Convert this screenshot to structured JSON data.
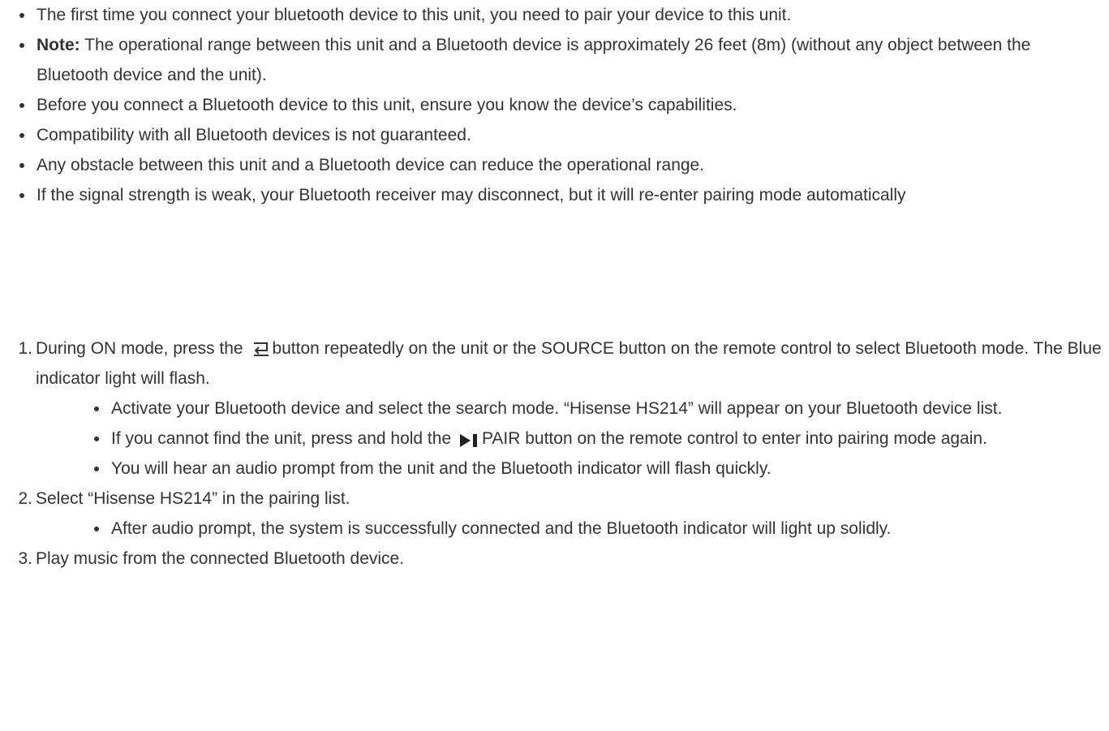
{
  "notes": [
    {
      "text": "The first time you connect your bluetooth device to this unit, you need to pair your device to this unit."
    },
    {
      "label": "Note:",
      "text": " The operational range between this unit and a Bluetooth device is approximately 26 feet (8m) (without any object between the Bluetooth device and the unit)."
    },
    {
      "text": "Before you connect a Bluetooth device to this unit, ensure you know the device’s capabilities."
    },
    {
      "text": "Compatibility with all Bluetooth devices is not guaranteed."
    },
    {
      "text": "Any obstacle between this unit and a Bluetooth device can reduce the operational range."
    },
    {
      "text": "If the signal strength is weak, your Bluetooth receiver may disconnect, but it will re-enter pairing mode automatically"
    }
  ],
  "steps": [
    {
      "number": "1.",
      "text_before_icon": "During ON mode, press the ",
      "icon": "source-icon",
      "text_after_icon": "button repeatedly on the unit or the SOURCE button on the remote control to select Bluetooth mode. The Blue indicator light will flash.",
      "sub": [
        {
          "text": "Activate your Bluetooth device and select the search mode. “Hisense HS214” will appear on your Bluetooth device list."
        },
        {
          "text_before_icon": "If you cannot find the unit, press and hold the ",
          "icon": "play-pause-icon",
          "text_after_icon": "PAIR button on the remote control to enter into pairing mode again."
        },
        {
          "text": "You will hear an audio prompt from the unit and the Bluetooth indicator will flash quickly."
        }
      ]
    },
    {
      "number": "2.",
      "text": "Select “Hisense HS214” in the pairing list.",
      "sub": [
        {
          "text": "After audio prompt, the system is successfully connected and the Bluetooth indicator will light up solidly."
        }
      ]
    },
    {
      "number": "3.",
      "text": "Play music from the connected Bluetooth device."
    }
  ]
}
